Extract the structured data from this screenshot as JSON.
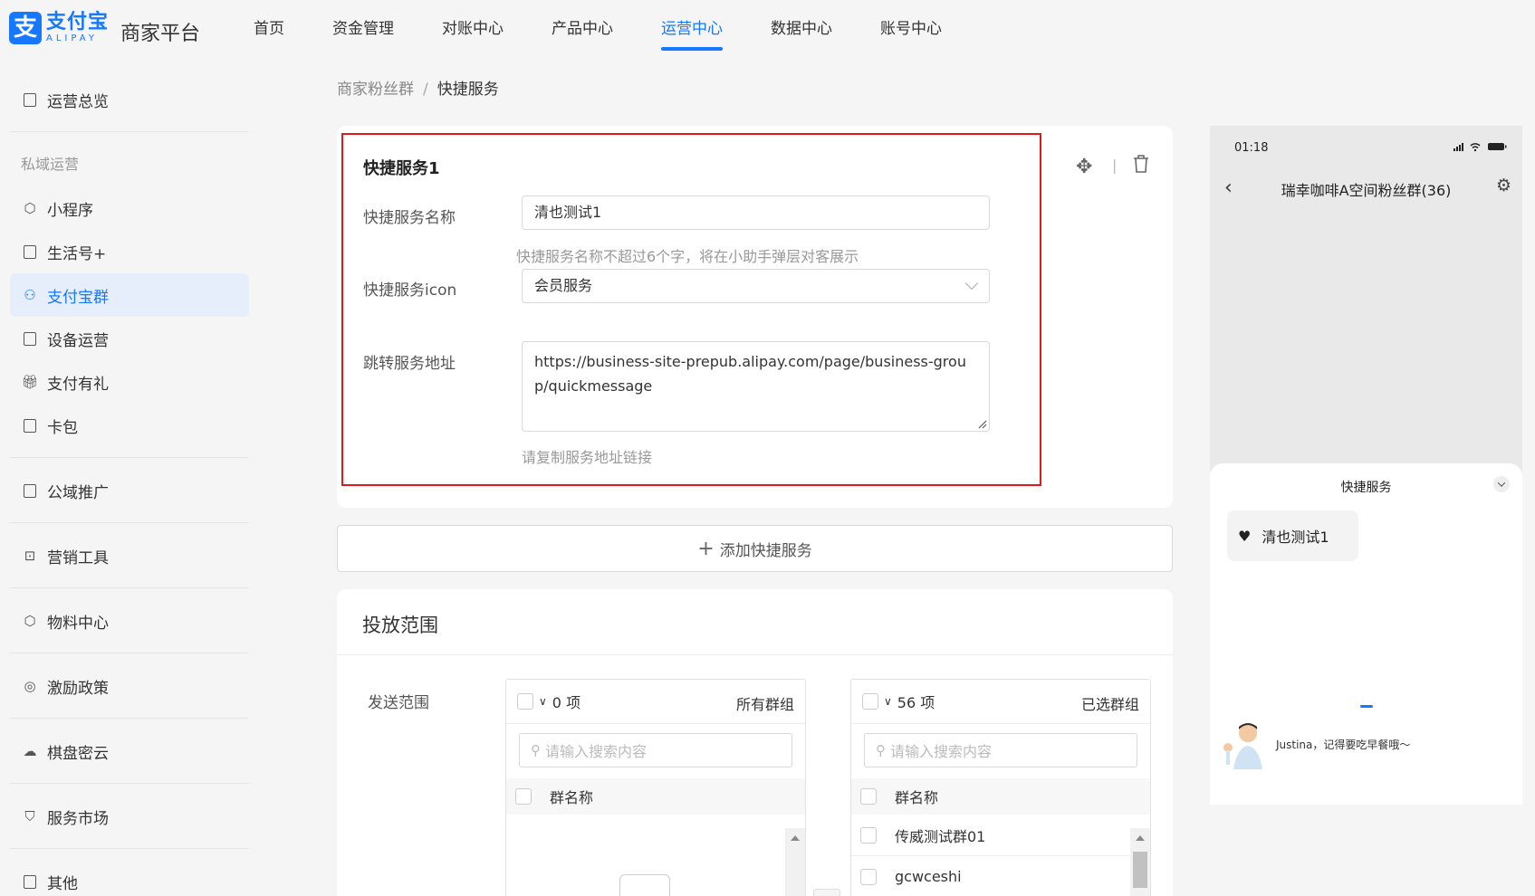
{
  "header": {
    "logo_cn": "支付宝",
    "logo_en": "ALIPAY",
    "platform": "商家平台",
    "nav": [
      {
        "label": "首页",
        "active": false
      },
      {
        "label": "资金管理",
        "active": false
      },
      {
        "label": "对账中心",
        "active": false
      },
      {
        "label": "产品中心",
        "active": false
      },
      {
        "label": "运营中心",
        "active": true
      },
      {
        "label": "数据中心",
        "active": false
      },
      {
        "label": "账号中心",
        "active": false
      }
    ]
  },
  "sidebar": {
    "overview": "运营总览",
    "group_private": "私域运营",
    "items": [
      "小程序",
      "生活号+",
      "支付宝群",
      "设备运营",
      "支付有礼",
      "卡包"
    ],
    "active_index": 2,
    "public": "公域推广",
    "marketing": "营销工具",
    "material": "物料中心",
    "incentive": "激励政策",
    "cloud": "棋盘密云",
    "market": "服务市场",
    "other": "其他"
  },
  "breadcrumb": {
    "parent": "商家粉丝群",
    "separator": "/",
    "current": "快捷服务"
  },
  "service": {
    "title": "快捷服务1",
    "name_label": "快捷服务名称",
    "name_value": "清也测试1",
    "name_help": "快捷服务名称不超过6个字，将在小助手弹层对客展示",
    "icon_label": "快捷服务icon",
    "icon_value": "会员服务",
    "url_label": "跳转服务地址",
    "url_value": "https://business-site-prepub.alipay.com/page/business-group/quickmessage",
    "url_help": "请复制服务地址链接",
    "tool_sep": "|"
  },
  "add_button": "添加快捷服务",
  "scope": {
    "title": "投放范围",
    "send_label": "发送范围",
    "left": {
      "count": "0 项",
      "title": "所有群组",
      "search_placeholder": "请输入搜索内容",
      "col": "群名称",
      "rows": []
    },
    "right": {
      "count": "56 项",
      "title": "已选群组",
      "search_placeholder": "请输入搜索内容",
      "col": "群名称",
      "rows": [
        "传威测试群01",
        "gcwceshi"
      ]
    }
  },
  "phone": {
    "time": "01:18",
    "chat_title": "瑞幸咖啡A空间粉丝群(36)",
    "sheet_title": "快捷服务",
    "chip": "清也测试1",
    "assistant_msg": "Justina，记得要吃早餐哦～"
  },
  "colors": {
    "accent": "#1677ff",
    "highlight": "#e01a1a"
  }
}
